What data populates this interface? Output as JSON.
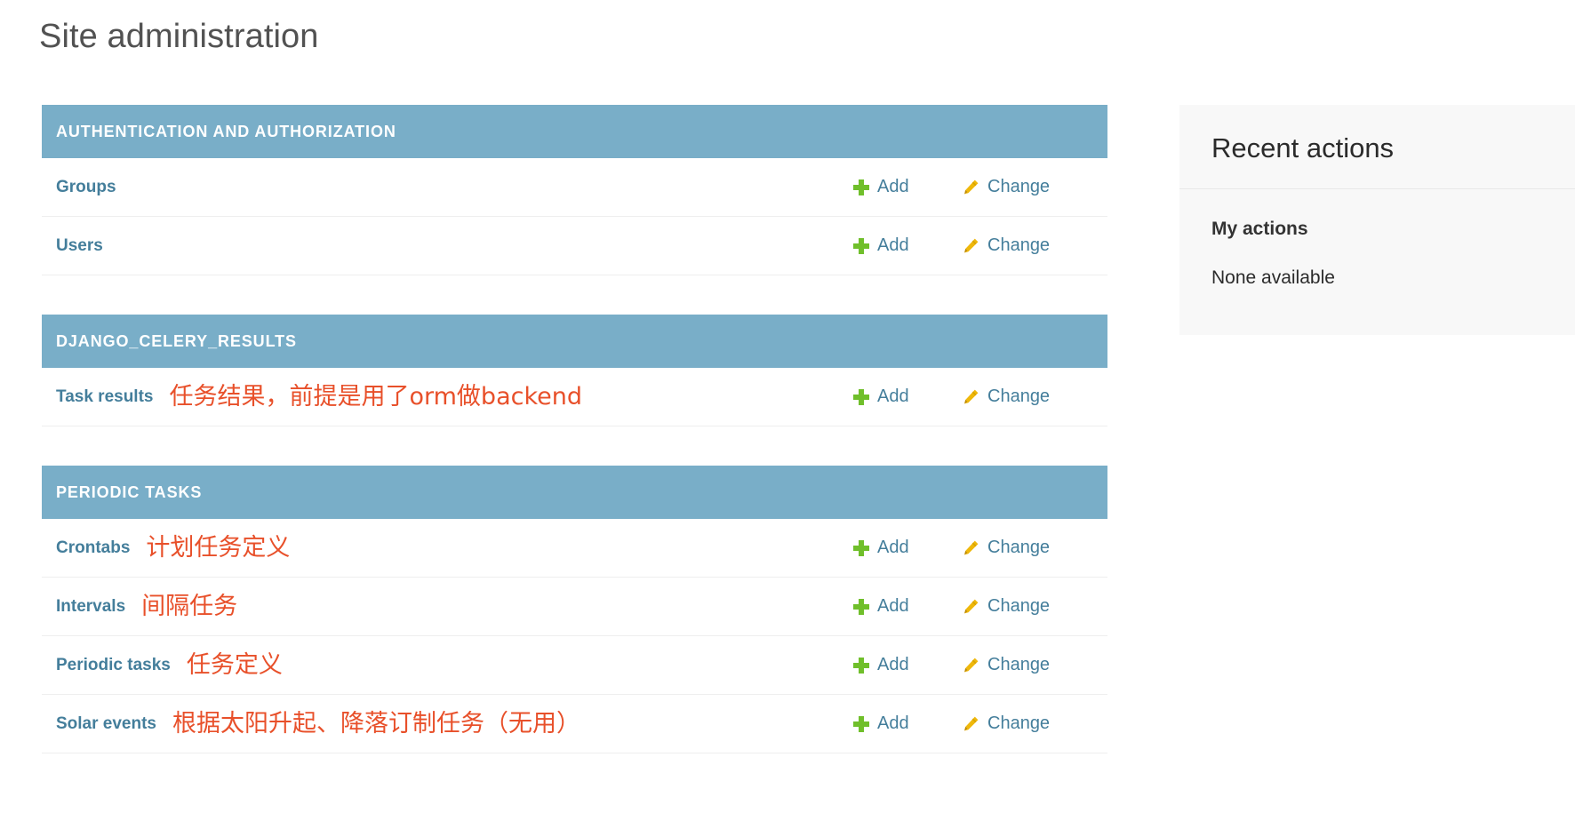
{
  "page": {
    "title": "Site administration"
  },
  "colors": {
    "module_header_bg": "#79aec8",
    "link": "#447e9b",
    "add_icon": "#70bf2b",
    "change_icon": "#efb80b",
    "annotation": "#e8502a",
    "sidebar_bg": "#f8f8f8"
  },
  "actions": {
    "add_label": "Add",
    "change_label": "Change",
    "add_icon": "plus-icon",
    "change_icon": "pencil-icon"
  },
  "modules": [
    {
      "caption": "AUTHENTICATION AND AUTHORIZATION",
      "models": [
        {
          "name": "Groups",
          "note": ""
        },
        {
          "name": "Users",
          "note": ""
        }
      ]
    },
    {
      "caption": "DJANGO_CELERY_RESULTS",
      "models": [
        {
          "name": "Task results",
          "note": "任务结果，前提是用了orm做backend"
        }
      ]
    },
    {
      "caption": "PERIODIC TASKS",
      "models": [
        {
          "name": "Crontabs",
          "note": "计划任务定义"
        },
        {
          "name": "Intervals",
          "note": "间隔任务"
        },
        {
          "name": "Periodic tasks",
          "note": "任务定义"
        },
        {
          "name": "Solar events",
          "note": "根据太阳升起、降落订制任务（无用）"
        }
      ]
    }
  ],
  "sidebar": {
    "title": "Recent actions",
    "subtitle": "My actions",
    "empty_text": "None available"
  }
}
